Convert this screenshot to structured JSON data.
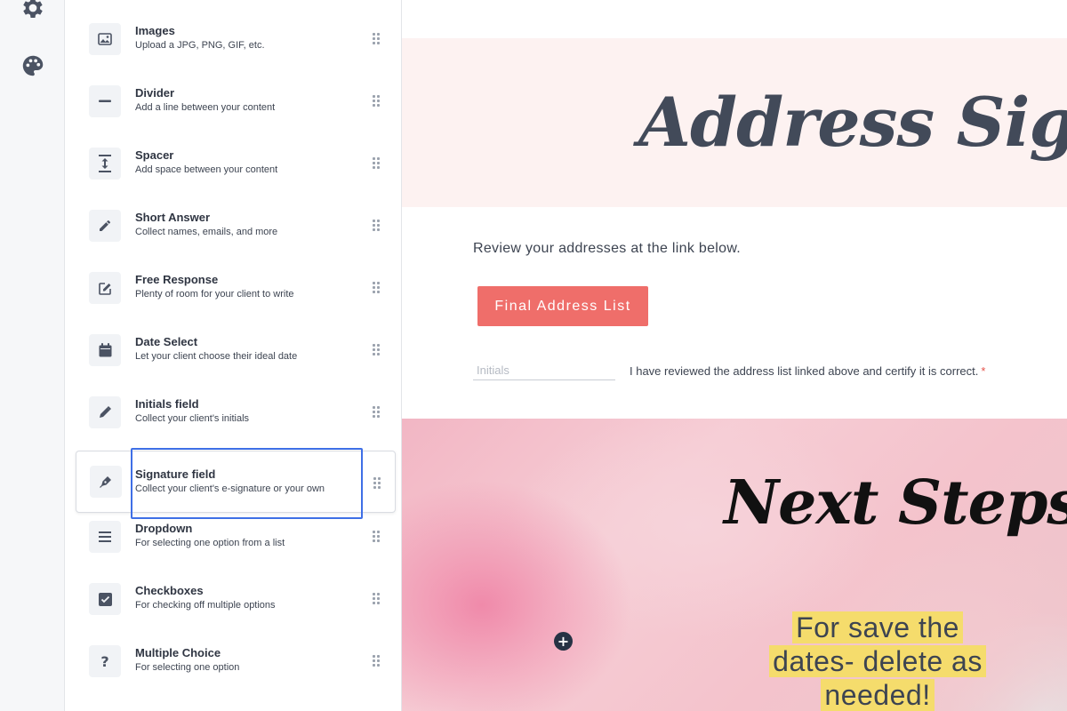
{
  "rail": {
    "icons": [
      "gear-icon",
      "palette-icon"
    ]
  },
  "elements_panel": {
    "items": [
      {
        "title": "Images",
        "description": "Upload a JPG, PNG, GIF, etc.",
        "icon": "image-icon"
      },
      {
        "title": "Divider",
        "description": "Add a line between your content",
        "icon": "minus-icon"
      },
      {
        "title": "Spacer",
        "description": "Add space between your content",
        "icon": "spacer-icon"
      },
      {
        "title": "Short Answer",
        "description": "Collect names, emails, and more",
        "icon": "pencil-icon"
      },
      {
        "title": "Free Response",
        "description": "Plenty of room for your client to write",
        "icon": "edit-box-icon"
      },
      {
        "title": "Date Select",
        "description": "Let your client choose their ideal date",
        "icon": "calendar-icon"
      },
      {
        "title": "Initials field",
        "description": "Collect your client's initials",
        "icon": "pen-icon"
      },
      {
        "title": "Signature field",
        "description": "Collect your client's e-signature or your own",
        "icon": "fountain-pen-icon",
        "selected": true
      },
      {
        "title": "Dropdown",
        "description": "For selecting one option from a list",
        "icon": "list-icon"
      },
      {
        "title": "Checkboxes",
        "description": "For checking off multiple options",
        "icon": "checkbox-icon"
      },
      {
        "title": "Multiple Choice",
        "description": "For selecting one option",
        "icon": "question-icon"
      }
    ]
  },
  "canvas": {
    "heading": "Address Sign-Off",
    "review_text": "Review your addresses at the link below.",
    "cta_label": "Final Address List",
    "initials_placeholder": "Initials",
    "certify_text": "I have reviewed the address list linked above and certify it is correct.",
    "required_mark": "*",
    "next_steps_title": "Next Steps",
    "note_lines": [
      "For save the",
      "dates- delete as",
      "needed!"
    ],
    "add_symbol": "+"
  },
  "colors": {
    "accent_button": "#ef6e6a",
    "selection_outline": "#3f6fe6",
    "title_band": "#fdf2f1",
    "highlight": "#f5dc6c",
    "add_button": "#263244"
  }
}
